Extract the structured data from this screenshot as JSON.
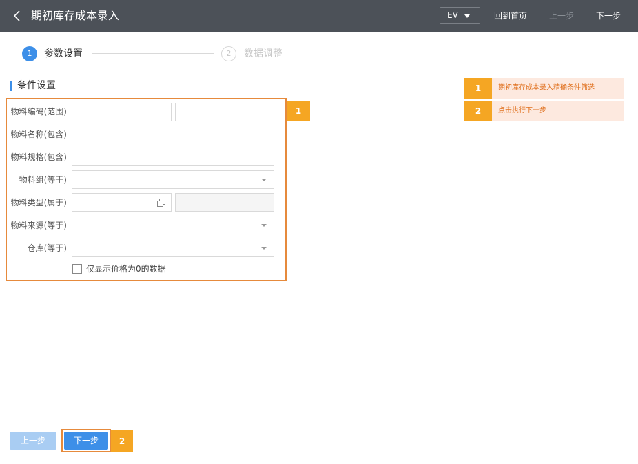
{
  "header": {
    "title": "期初库存成本录入",
    "lang": "EV",
    "home": "回到首页",
    "prev": "上一步",
    "next": "下一步"
  },
  "stepper": {
    "steps": [
      {
        "num": "1",
        "label": "参数设置",
        "active": true
      },
      {
        "num": "2",
        "label": "数据调整",
        "active": false
      }
    ]
  },
  "section": {
    "title": "条件设置"
  },
  "form": {
    "fields": [
      {
        "label": "物料编码(范围)",
        "value_from": "",
        "value_to": ""
      },
      {
        "label": "物料名称(包含)",
        "value": ""
      },
      {
        "label": "物料规格(包含)",
        "value": ""
      },
      {
        "label": "物料组(等于)",
        "value": ""
      },
      {
        "label": "物料类型(属于)",
        "value": "",
        "value_extra": ""
      },
      {
        "label": "物料来源(等于)",
        "value": ""
      },
      {
        "label": "仓库(等于)",
        "value": ""
      }
    ],
    "checkbox_label": "仅显示价格为0的数据",
    "checkbox_checked": false
  },
  "badges": {
    "form": "1",
    "next_button": "2"
  },
  "tips": [
    {
      "num": "1",
      "text": "期初库存成本录入精确条件筛选"
    },
    {
      "num": "2",
      "text": "点击执行下一步"
    }
  ],
  "footer": {
    "prev": "上一步",
    "next": "下一步"
  },
  "colors": {
    "header_bg": "#4c5158",
    "accent": "#3d8fe8",
    "highlight": "#e68a3c",
    "badge": "#f5a623",
    "tip_bg": "#fde9df"
  }
}
